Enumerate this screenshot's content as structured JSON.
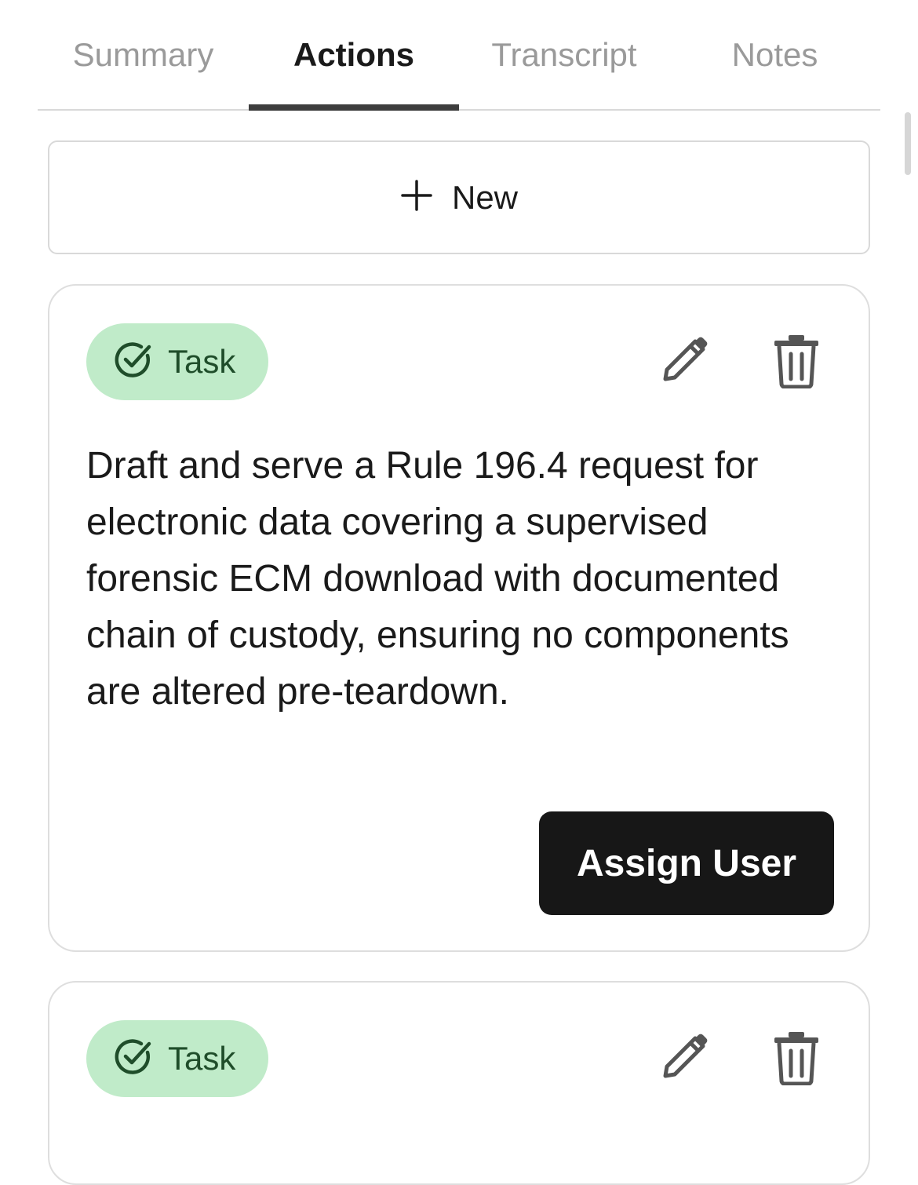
{
  "tabs": [
    {
      "label": "Summary"
    },
    {
      "label": "Actions"
    },
    {
      "label": "Transcript"
    },
    {
      "label": "Notes"
    }
  ],
  "active_tab": "Actions",
  "new_button": {
    "label": "New",
    "icon": "plus-icon"
  },
  "cards": [
    {
      "badge": {
        "label": "Task",
        "icon": "check-circle-icon",
        "color": "#c0ebc9"
      },
      "text": "Draft and serve a Rule 196.4 request for electronic data covering a supervised forensic ECM download with documented chain of custody, ensuring no components are altered pre-teardown.",
      "assign_label": "Assign User",
      "actions": {
        "edit_icon": "pencil-icon",
        "delete_icon": "trash-icon"
      }
    },
    {
      "badge": {
        "label": "Task",
        "icon": "check-circle-icon",
        "color": "#c0ebc9"
      },
      "actions": {
        "edit_icon": "pencil-icon",
        "delete_icon": "trash-icon"
      }
    }
  ]
}
